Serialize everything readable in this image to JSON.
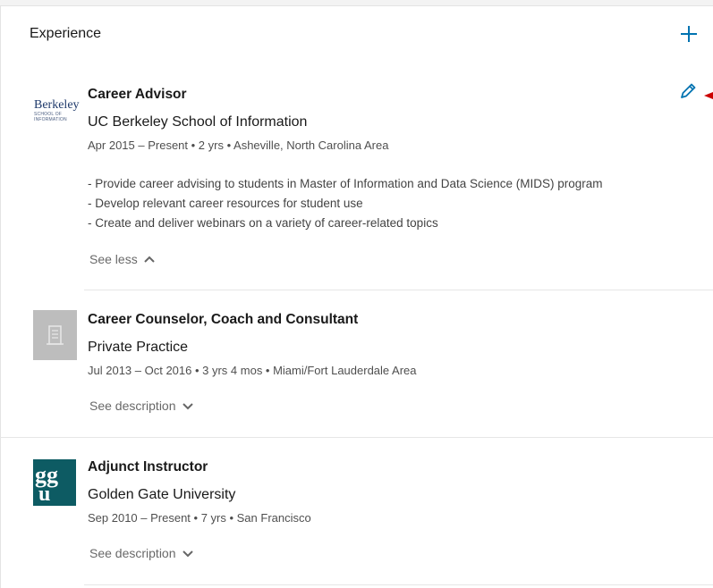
{
  "section": {
    "title": "Experience",
    "add_icon": "plus-icon",
    "edit_icon": "pencil-icon"
  },
  "colors": {
    "accent": "#0073b1",
    "meta": "#666666",
    "divider": "#e6e6e6",
    "arrow": "#cc0000"
  },
  "entries": [
    {
      "logo_text": "Berkeley",
      "logo_sub": [
        "SCHOOL OF",
        "INFORMATION"
      ],
      "title": "Career Advisor",
      "company": "UC Berkeley School of Information",
      "meta": "Apr 2015 – Present • 2 yrs • Asheville, North Carolina Area",
      "description": [
        "- Provide career advising to students in Master of Information and Data Science (MIDS) program",
        "- Develop relevant career resources for student use",
        "- Create and deliver webinars on a variety of career-related topics"
      ],
      "toggle_label": "See less"
    },
    {
      "logo_icon": "building-icon",
      "title": "Career Counselor, Coach and Consultant",
      "company": "Private Practice",
      "meta": "Jul 2013 – Oct 2016 • 3 yrs 4 mos • Miami/Fort Lauderdale Area",
      "toggle_label": "See description"
    },
    {
      "logo_icon": "ggu-logo",
      "title": "Adjunct Instructor",
      "company": "Golden Gate University",
      "meta": "Sep 2010 – Present • 7 yrs • San Francisco",
      "toggle_label": "See description"
    }
  ]
}
